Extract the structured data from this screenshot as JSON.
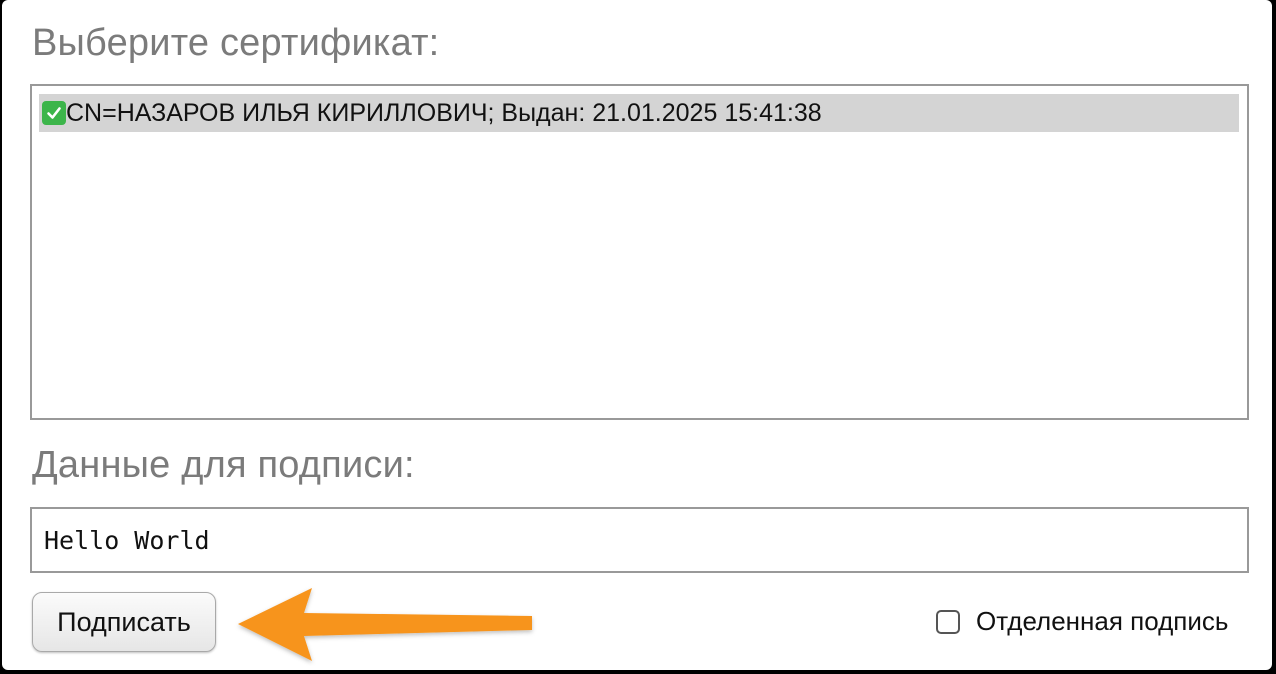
{
  "certificate_section": {
    "title": "Выберите сертификат:",
    "certificates": [
      {
        "icon": "check-mark-button-icon",
        "label": "CN=НАЗАРОВ ИЛЬЯ КИРИЛЛОВИЧ; Выдан: 21.01.2025 15:41:38",
        "selected": true
      }
    ]
  },
  "data_section": {
    "title": "Данные для подписи:",
    "value": "Hello World"
  },
  "actions": {
    "sign_label": "Подписать",
    "detached_label": "Отделенная подпись",
    "detached_checked": false
  },
  "annotation": {
    "arrow_color": "#f7941d",
    "arrow_target": "sign-button"
  },
  "colors": {
    "heading": "#7b7b7b",
    "selection": "#d4d4d4",
    "check_icon": "#3cb54a"
  }
}
